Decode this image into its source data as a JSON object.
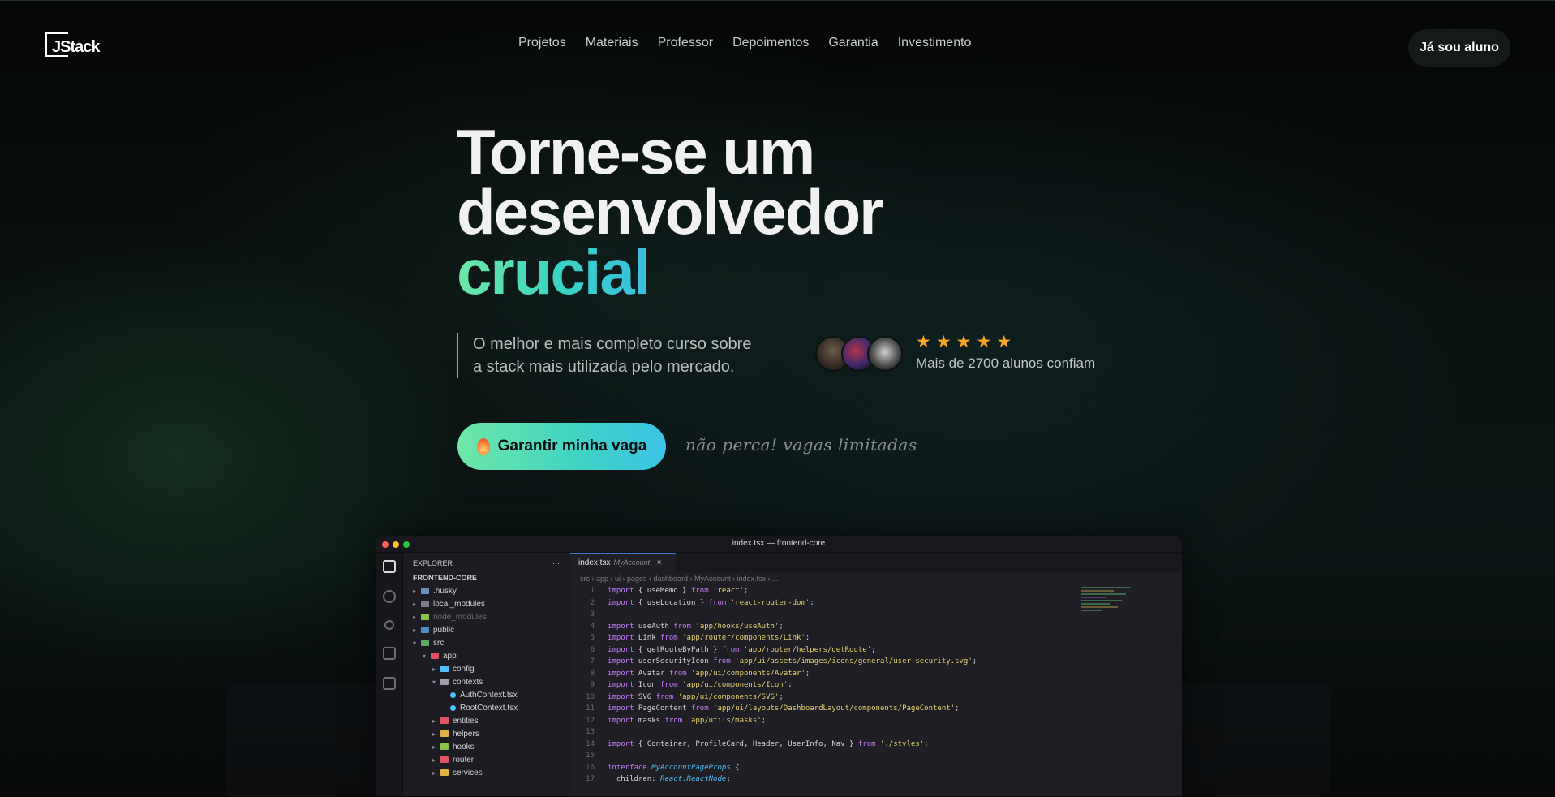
{
  "brand": {
    "logo_text": "JStack"
  },
  "nav": {
    "items": [
      "Projetos",
      "Materiais",
      "Professor",
      "Depoimentos",
      "Garantia",
      "Investimento"
    ],
    "student_button": "Já sou aluno"
  },
  "hero": {
    "title_line1": "Torne-se um",
    "title_line2": "desenvolvedor",
    "title_highlight": "crucial",
    "subtitle_line1": "O melhor e mais completo curso sobre",
    "subtitle_line2": "a stack mais utilizada pelo mercado.",
    "rating_stars": 5,
    "rating_text": "Mais de 2700 alunos confiam",
    "cta_label": "Garantir minha vaga",
    "cta_note": "não perca! vagas limitadas",
    "accent_gradient": [
      "#6ee7a6",
      "#3fd2c6",
      "#3cc2e6"
    ]
  },
  "editor": {
    "window_title": "index.tsx — frontend-core",
    "explorer_label": "EXPLORER",
    "project_name": "FRONTEND-CORE",
    "tab_file": "index.tsx",
    "tab_context": "MyAccount",
    "breadcrumb": "src › app › ui › pages › dashboard › MyAccount › index.tsx › ...",
    "tree": [
      {
        "name": ".husky",
        "depth": 0,
        "dim": false
      },
      {
        "name": "local_modules",
        "depth": 0,
        "dim": false
      },
      {
        "name": "node_modules",
        "depth": 0,
        "dim": true
      },
      {
        "name": "public",
        "depth": 0,
        "dim": false
      },
      {
        "name": "src",
        "depth": 0,
        "dim": false
      },
      {
        "name": "app",
        "depth": 1,
        "dim": false
      },
      {
        "name": "config",
        "depth": 2,
        "dim": false
      },
      {
        "name": "contexts",
        "depth": 2,
        "dim": false
      },
      {
        "name": "AuthContext.tsx",
        "depth": 3,
        "dim": false
      },
      {
        "name": "RootContext.tsx",
        "depth": 3,
        "dim": false
      },
      {
        "name": "entities",
        "depth": 2,
        "dim": false
      },
      {
        "name": "helpers",
        "depth": 2,
        "dim": false
      },
      {
        "name": "hooks",
        "depth": 2,
        "dim": false
      },
      {
        "name": "router",
        "depth": 2,
        "dim": false
      },
      {
        "name": "services",
        "depth": 2,
        "dim": false
      }
    ],
    "code_lines": [
      "import { useMemo } from 'react';",
      "import { useLocation } from 'react-router-dom';",
      "",
      "import useAuth from 'app/hooks/useAuth';",
      "import Link from 'app/router/components/Link';",
      "import { getRouteByPath } from 'app/router/helpers/getRoute';",
      "import userSecurityIcon from 'app/ui/assets/images/icons/general/user-security.svg';",
      "import Avatar from 'app/ui/components/Avatar';",
      "import Icon from 'app/ui/components/Icon';",
      "import SVG from 'app/ui/components/SVG';",
      "import PageContent from 'app/ui/layouts/DashboardLayout/components/PageContent';",
      "import masks from 'app/utils/masks';",
      "",
      "import { Container, ProfileCard, Header, UserInfo, Nav } from './styles';",
      "",
      "interface MyAccountPageProps {",
      "  children: React.ReactNode;"
    ]
  }
}
